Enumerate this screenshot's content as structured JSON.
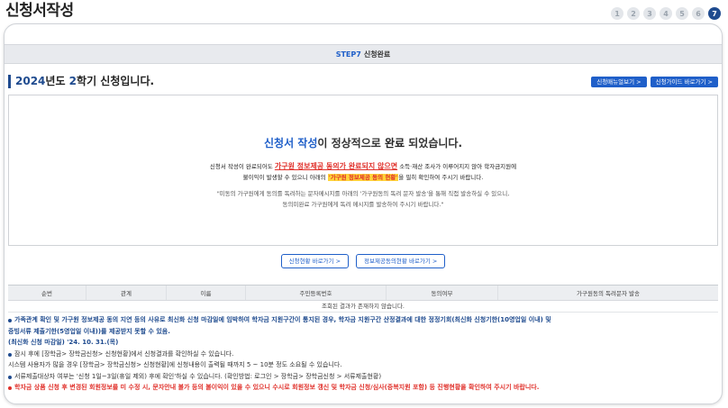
{
  "page": {
    "title": "신청서작성"
  },
  "steps": [
    "1",
    "2",
    "3",
    "4",
    "5",
    "6",
    "7"
  ],
  "banner": {
    "step_label": "STEP7",
    "step_name": "신청완료"
  },
  "heading": {
    "year": "2024",
    "mid1": "년도 ",
    "term": "2",
    "rest": "학기 신청입니다."
  },
  "top_buttons": {
    "manual": "신청매뉴얼보기 >",
    "guide": "신청가이드 바로가기 >"
  },
  "result": {
    "title_blue": "신청서 작성",
    "title_mid": "이 정상적으로 ",
    "title_dark": "완료",
    "title_end": " 되었습니다.",
    "line1_pre": "신청서 작성이 완료되어도 ",
    "line1_red": "가구원 정보제공 동의가 완료되지 않으면",
    "line1_post": " 소득·재산 조사가 이루어지지 않아 학자금지원에",
    "line2_pre": "불이익이 발생할 수 있으니 아래의 ",
    "line2_hl": "'가구원 정보제공 동의 현황'",
    "line2_post": "을 필히 확인하여 주시기 바랍니다.",
    "line3": "\"미동의 가구원에게 동의를 독려하는 문자메시지를 아래의 '가구원동의 독려 문자 발송'을 통해 직접 발송하실 수 있으니,",
    "line4": "동의미완료 가구원에게 독려 메시지를 발송하여 주시기 바랍니다.\""
  },
  "action_buttons": {
    "status": "신청현황 바로가기 >",
    "consent": "정보제공동의현황 바로가기 >"
  },
  "table": {
    "headers": [
      "순번",
      "관계",
      "이름",
      "주민등록번호",
      "동의여부",
      "가구원동의 독려문자 발송"
    ],
    "empty_text": "조회된 결과가 존재하지 않습니다."
  },
  "notes": {
    "n1": "가족관계 확인 및 가구원 정보제공 동의 지연 등의 사유로 최신화 신청 마감일에 임박하여 학자금 지원구간이 통지된 경우, 학자금 지원구간 산정결과에 대한 정정기회(최신화 신청기한(10영업일 이내) 및",
    "n1b": "증빙서류 제출기한(5영업일 이내))를 제공받지 못할 수 있음.",
    "n1c": "(최신화 신청 마감일) '24. 10. 31.(목)",
    "n2": "잠시 후에 [장학금> 장학금신청> 신청현황]에서 신청결과를 확인하실 수 있습니다.",
    "n3": "시스템 사용자가 많을 경우 [장학금> 장학금신청> 신청현황]에 신청내용이 출력될 때까지 5 ~ 10분 정도 소요될 수 있습니다.",
    "n4": "서류제출대상자 여부는 '신청 1일~3일(휴일 제외) 후에 확인'하실 수 있습니다. (확인방법: 로그인 > 장학금> 장학금신청 > 서류제출현황)",
    "n5": "학자금 상품 신청 후 변경된 회원정보를 미 수정 시, 문자안내 불가 등의 불이익이 있을 수 있으니 수시로 회원정보 갱신 및 학자금 신청/심사(증복지원 포함) 등 진행현황을 확인하여 주시기 바랍니다."
  }
}
